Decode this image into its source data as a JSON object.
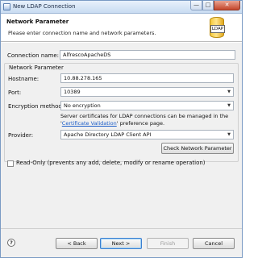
{
  "window": {
    "title": "New LDAP Connection",
    "buttons": {
      "minimize": "—",
      "maximize": "□",
      "close": "✕"
    }
  },
  "header": {
    "title": "Network Parameter",
    "description": "Please enter connection name and network parameters.",
    "logo_text": "LDAP"
  },
  "form": {
    "connection_name_label": "Connection name:",
    "connection_name_value": "AlfrescoApacheDS",
    "group_label": "Network Parameter",
    "hostname_label": "Hostname:",
    "hostname_value": "10.88.278.165",
    "port_label": "Port:",
    "port_value": "10389",
    "encryption_label": "Encryption method:",
    "encryption_value": "No encryption",
    "info_text_1": "Server certificates for LDAP connections can be managed in the '",
    "info_link": "Certificate Validation",
    "info_text_2": "' preference page.",
    "provider_label": "Provider:",
    "provider_value": "Apache Directory LDAP Client API",
    "check_button": "Check Network Parameter",
    "readonly_label": "Read-Only (prevents any add, delete, modify or rename operation)"
  },
  "footer": {
    "help": "?",
    "back": "< Back",
    "next": "Next >",
    "finish": "Finish",
    "cancel": "Cancel"
  }
}
